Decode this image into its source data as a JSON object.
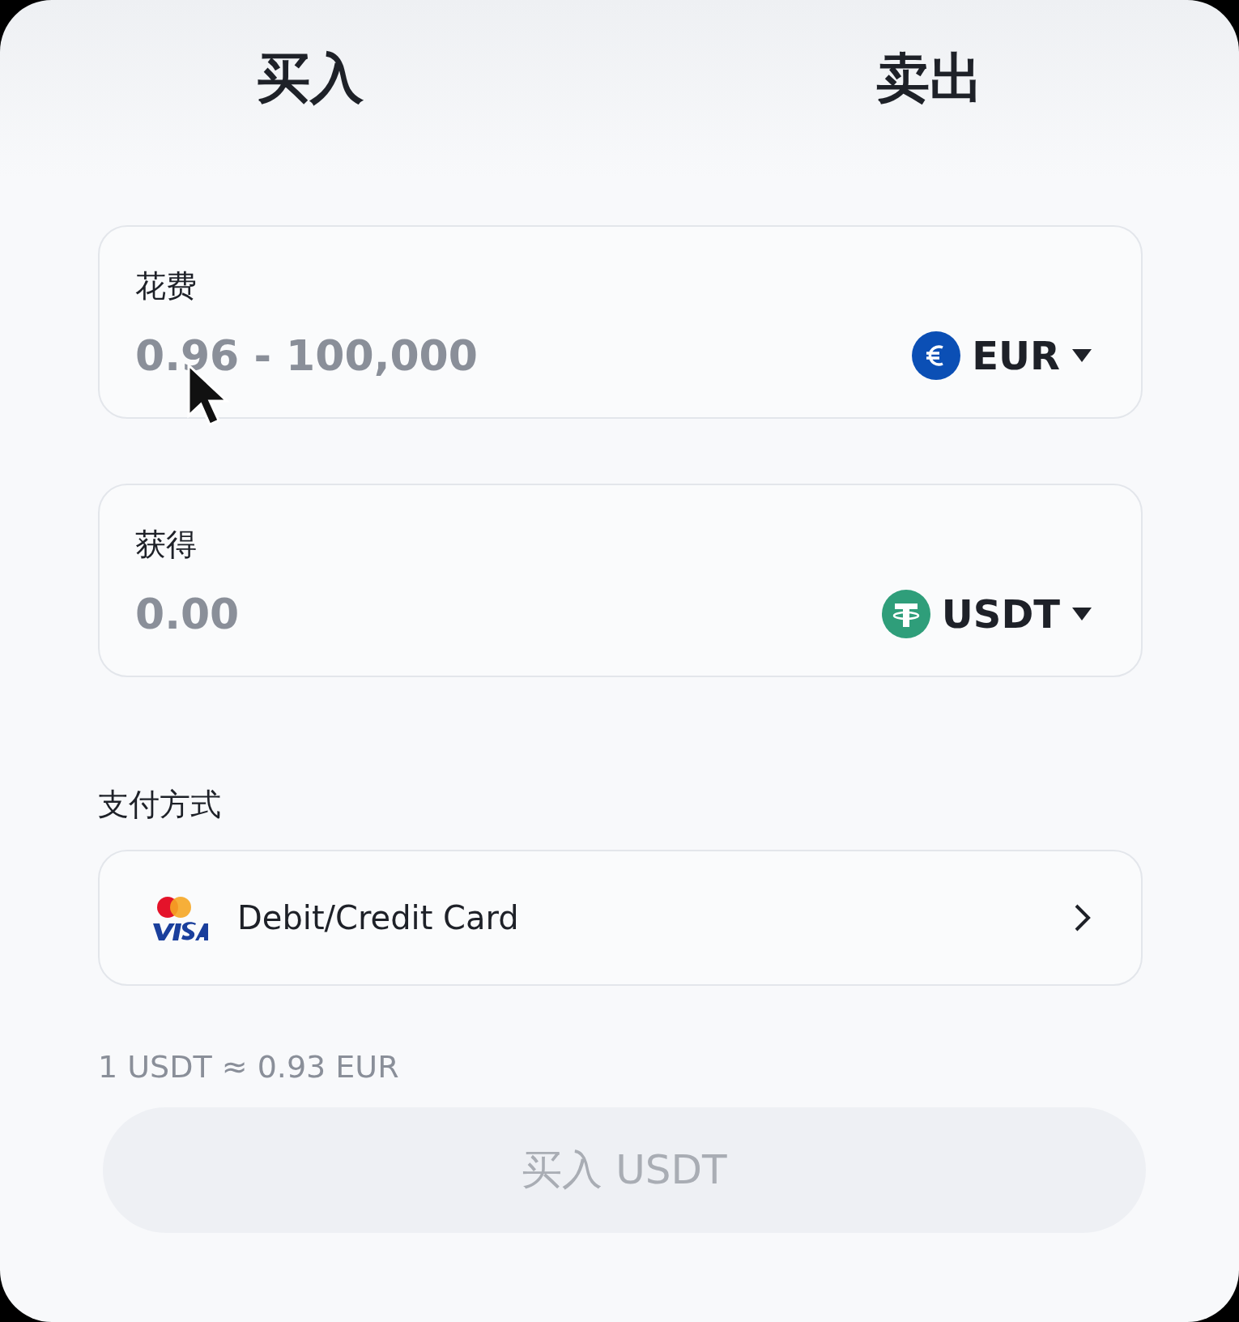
{
  "tabs": [
    {
      "label": "买入"
    },
    {
      "label": "卖出"
    }
  ],
  "spend": {
    "label": "花费",
    "placeholder": "0.96 - 100,000",
    "currency": {
      "code": "EUR",
      "kind": "euro"
    }
  },
  "receive": {
    "label": "获得",
    "placeholder": "0.00",
    "currency": {
      "code": "USDT",
      "kind": "tether"
    }
  },
  "payment": {
    "label": "支付方式",
    "method": "Debit/Credit Card"
  },
  "rate": "1 USDT ≈ 0.93 EUR",
  "submit": {
    "label": "买入 USDT",
    "disabled": true
  }
}
